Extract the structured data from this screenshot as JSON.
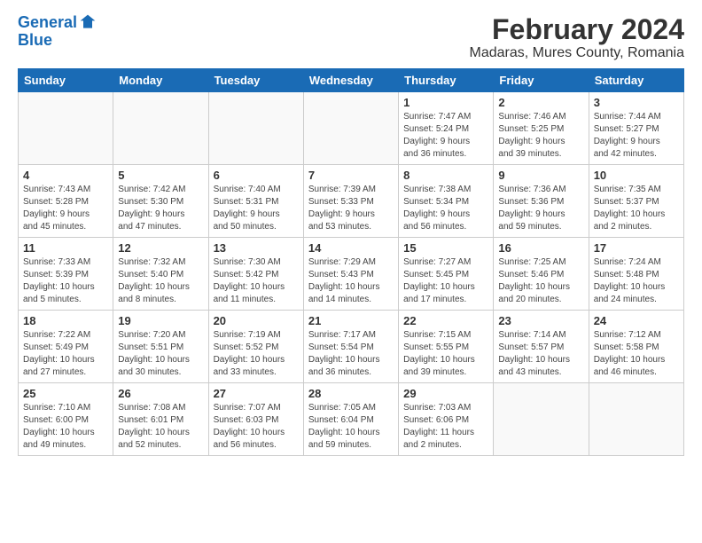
{
  "logo": {
    "line1": "General",
    "line2": "Blue"
  },
  "title": "February 2024",
  "location": "Madaras, Mures County, Romania",
  "days_header": [
    "Sunday",
    "Monday",
    "Tuesday",
    "Wednesday",
    "Thursday",
    "Friday",
    "Saturday"
  ],
  "weeks": [
    [
      {
        "day": "",
        "info": ""
      },
      {
        "day": "",
        "info": ""
      },
      {
        "day": "",
        "info": ""
      },
      {
        "day": "",
        "info": ""
      },
      {
        "day": "1",
        "info": "Sunrise: 7:47 AM\nSunset: 5:24 PM\nDaylight: 9 hours\nand 36 minutes."
      },
      {
        "day": "2",
        "info": "Sunrise: 7:46 AM\nSunset: 5:25 PM\nDaylight: 9 hours\nand 39 minutes."
      },
      {
        "day": "3",
        "info": "Sunrise: 7:44 AM\nSunset: 5:27 PM\nDaylight: 9 hours\nand 42 minutes."
      }
    ],
    [
      {
        "day": "4",
        "info": "Sunrise: 7:43 AM\nSunset: 5:28 PM\nDaylight: 9 hours\nand 45 minutes."
      },
      {
        "day": "5",
        "info": "Sunrise: 7:42 AM\nSunset: 5:30 PM\nDaylight: 9 hours\nand 47 minutes."
      },
      {
        "day": "6",
        "info": "Sunrise: 7:40 AM\nSunset: 5:31 PM\nDaylight: 9 hours\nand 50 minutes."
      },
      {
        "day": "7",
        "info": "Sunrise: 7:39 AM\nSunset: 5:33 PM\nDaylight: 9 hours\nand 53 minutes."
      },
      {
        "day": "8",
        "info": "Sunrise: 7:38 AM\nSunset: 5:34 PM\nDaylight: 9 hours\nand 56 minutes."
      },
      {
        "day": "9",
        "info": "Sunrise: 7:36 AM\nSunset: 5:36 PM\nDaylight: 9 hours\nand 59 minutes."
      },
      {
        "day": "10",
        "info": "Sunrise: 7:35 AM\nSunset: 5:37 PM\nDaylight: 10 hours\nand 2 minutes."
      }
    ],
    [
      {
        "day": "11",
        "info": "Sunrise: 7:33 AM\nSunset: 5:39 PM\nDaylight: 10 hours\nand 5 minutes."
      },
      {
        "day": "12",
        "info": "Sunrise: 7:32 AM\nSunset: 5:40 PM\nDaylight: 10 hours\nand 8 minutes."
      },
      {
        "day": "13",
        "info": "Sunrise: 7:30 AM\nSunset: 5:42 PM\nDaylight: 10 hours\nand 11 minutes."
      },
      {
        "day": "14",
        "info": "Sunrise: 7:29 AM\nSunset: 5:43 PM\nDaylight: 10 hours\nand 14 minutes."
      },
      {
        "day": "15",
        "info": "Sunrise: 7:27 AM\nSunset: 5:45 PM\nDaylight: 10 hours\nand 17 minutes."
      },
      {
        "day": "16",
        "info": "Sunrise: 7:25 AM\nSunset: 5:46 PM\nDaylight: 10 hours\nand 20 minutes."
      },
      {
        "day": "17",
        "info": "Sunrise: 7:24 AM\nSunset: 5:48 PM\nDaylight: 10 hours\nand 24 minutes."
      }
    ],
    [
      {
        "day": "18",
        "info": "Sunrise: 7:22 AM\nSunset: 5:49 PM\nDaylight: 10 hours\nand 27 minutes."
      },
      {
        "day": "19",
        "info": "Sunrise: 7:20 AM\nSunset: 5:51 PM\nDaylight: 10 hours\nand 30 minutes."
      },
      {
        "day": "20",
        "info": "Sunrise: 7:19 AM\nSunset: 5:52 PM\nDaylight: 10 hours\nand 33 minutes."
      },
      {
        "day": "21",
        "info": "Sunrise: 7:17 AM\nSunset: 5:54 PM\nDaylight: 10 hours\nand 36 minutes."
      },
      {
        "day": "22",
        "info": "Sunrise: 7:15 AM\nSunset: 5:55 PM\nDaylight: 10 hours\nand 39 minutes."
      },
      {
        "day": "23",
        "info": "Sunrise: 7:14 AM\nSunset: 5:57 PM\nDaylight: 10 hours\nand 43 minutes."
      },
      {
        "day": "24",
        "info": "Sunrise: 7:12 AM\nSunset: 5:58 PM\nDaylight: 10 hours\nand 46 minutes."
      }
    ],
    [
      {
        "day": "25",
        "info": "Sunrise: 7:10 AM\nSunset: 6:00 PM\nDaylight: 10 hours\nand 49 minutes."
      },
      {
        "day": "26",
        "info": "Sunrise: 7:08 AM\nSunset: 6:01 PM\nDaylight: 10 hours\nand 52 minutes."
      },
      {
        "day": "27",
        "info": "Sunrise: 7:07 AM\nSunset: 6:03 PM\nDaylight: 10 hours\nand 56 minutes."
      },
      {
        "day": "28",
        "info": "Sunrise: 7:05 AM\nSunset: 6:04 PM\nDaylight: 10 hours\nand 59 minutes."
      },
      {
        "day": "29",
        "info": "Sunrise: 7:03 AM\nSunset: 6:06 PM\nDaylight: 11 hours\nand 2 minutes."
      },
      {
        "day": "",
        "info": ""
      },
      {
        "day": "",
        "info": ""
      }
    ]
  ]
}
